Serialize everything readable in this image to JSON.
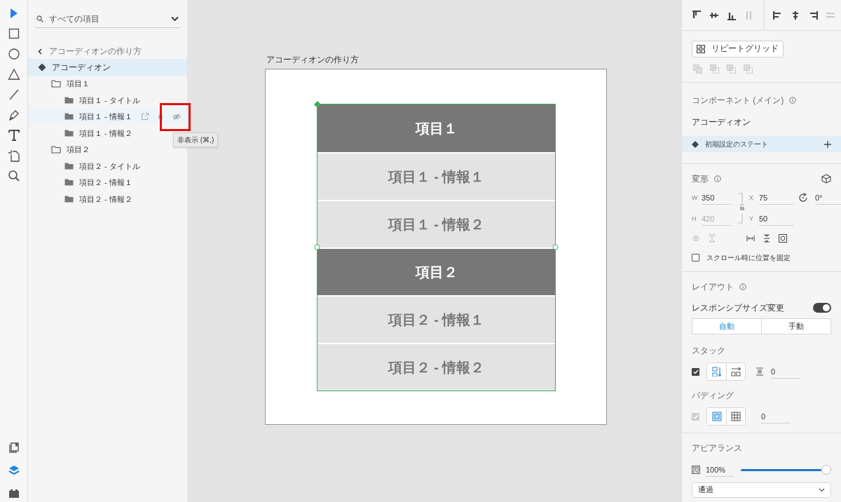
{
  "toolbar": {
    "tools": [
      {
        "kind": "select",
        "selected": true
      },
      {
        "kind": "rectangle",
        "selected": false
      },
      {
        "kind": "ellipse",
        "selected": false
      },
      {
        "kind": "triangle",
        "selected": false
      },
      {
        "kind": "line",
        "selected": false
      },
      {
        "kind": "pen",
        "selected": false
      },
      {
        "kind": "text",
        "selected": false
      },
      {
        "kind": "artboard",
        "selected": false
      },
      {
        "kind": "zoom",
        "selected": false
      }
    ],
    "bottom_tools": [
      {
        "kind": "assets",
        "selected": false
      },
      {
        "kind": "layers",
        "selected": true
      },
      {
        "kind": "plugins",
        "selected": false
      }
    ]
  },
  "layers": {
    "search": {
      "placeholder": "すべての項目"
    },
    "breadcrumb": "アコーディオンの作り方",
    "tree": [
      {
        "label": "アコーディオン",
        "kind": "component",
        "selected": true,
        "children": [
          {
            "label": "項目１",
            "kind": "group",
            "selected": false,
            "children": [
              {
                "label": "項目１ - タイトル",
                "kind": "group-filled",
                "selected": false
              },
              {
                "label": "項目１ - 情報１",
                "kind": "group-filled",
                "selected": false,
                "hovered": true,
                "highlighted": true,
                "tooltip": "非表示 (⌘,)"
              },
              {
                "label": "項目１ - 情報２",
                "kind": "group-filled",
                "selected": false
              }
            ]
          },
          {
            "label": "項目２",
            "kind": "group",
            "selected": false,
            "children": [
              {
                "label": "項目２ - タイトル",
                "kind": "group-filled",
                "selected": false
              },
              {
                "label": "項目２ - 情報１",
                "kind": "group-filled",
                "selected": false
              },
              {
                "label": "項目２ - 情報２",
                "kind": "group-filled",
                "selected": false
              }
            ]
          }
        ]
      }
    ]
  },
  "canvas": {
    "artboard_title": "アコーディオンの作り方",
    "rows": [
      {
        "kind": "header",
        "text": "項目１"
      },
      {
        "kind": "item",
        "text": "項目１ - 情報１"
      },
      {
        "kind": "item",
        "text": "項目１ - 情報２"
      },
      {
        "kind": "header",
        "text": "項目２"
      },
      {
        "kind": "item",
        "text": "項目２ - 情報１"
      },
      {
        "kind": "item",
        "text": "項目２ - 情報２"
      }
    ]
  },
  "properties": {
    "align": [
      {
        "kind": "top",
        "disabled": false
      },
      {
        "kind": "middle",
        "disabled": false
      },
      {
        "kind": "bottom",
        "disabled": false
      },
      {
        "kind": "distribute-v",
        "disabled": true
      },
      {
        "kind": "left",
        "disabled": false
      },
      {
        "kind": "center",
        "disabled": false
      },
      {
        "kind": "right",
        "disabled": false
      },
      {
        "kind": "distribute-h",
        "disabled": true
      }
    ],
    "repeat_grid": "リピートグリッド",
    "component": {
      "heading": "コンポーネント (メイン)",
      "name": "アコーディオン",
      "state": "初期設定のステート"
    },
    "transform": {
      "heading": "変形",
      "fields": [
        {
          "label": "W",
          "value": "350",
          "disabled": false
        },
        {
          "label": "X",
          "value": "75",
          "disabled": false
        },
        {
          "label": "H",
          "value": "420",
          "disabled": true
        },
        {
          "label": "Y",
          "value": "50",
          "disabled": false
        }
      ],
      "rotation": "0°",
      "fix_position": {
        "label": "スクロール時に位置を固定",
        "checked": false
      }
    },
    "layout": {
      "heading": "レイアウト",
      "responsive": {
        "label": "レスポンシブサイズ変更",
        "on": true
      },
      "modes": [
        {
          "label": "自動",
          "selected": true
        },
        {
          "label": "手動",
          "selected": false
        }
      ],
      "stack": {
        "heading": "スタック",
        "checked": true,
        "directions": [
          {
            "kind": "vertical",
            "selected": true
          },
          {
            "kind": "horizontal",
            "selected": false
          }
        ],
        "spacing": "0"
      },
      "padding": {
        "heading": "パディング",
        "checked": true,
        "modes": [
          {
            "kind": "uniform",
            "selected": true
          },
          {
            "kind": "individual",
            "selected": false
          }
        ],
        "value": "0"
      }
    },
    "appearance": {
      "heading": "アピアランス",
      "opacity": "100%",
      "level": 1.0,
      "blend": "通過"
    }
  }
}
